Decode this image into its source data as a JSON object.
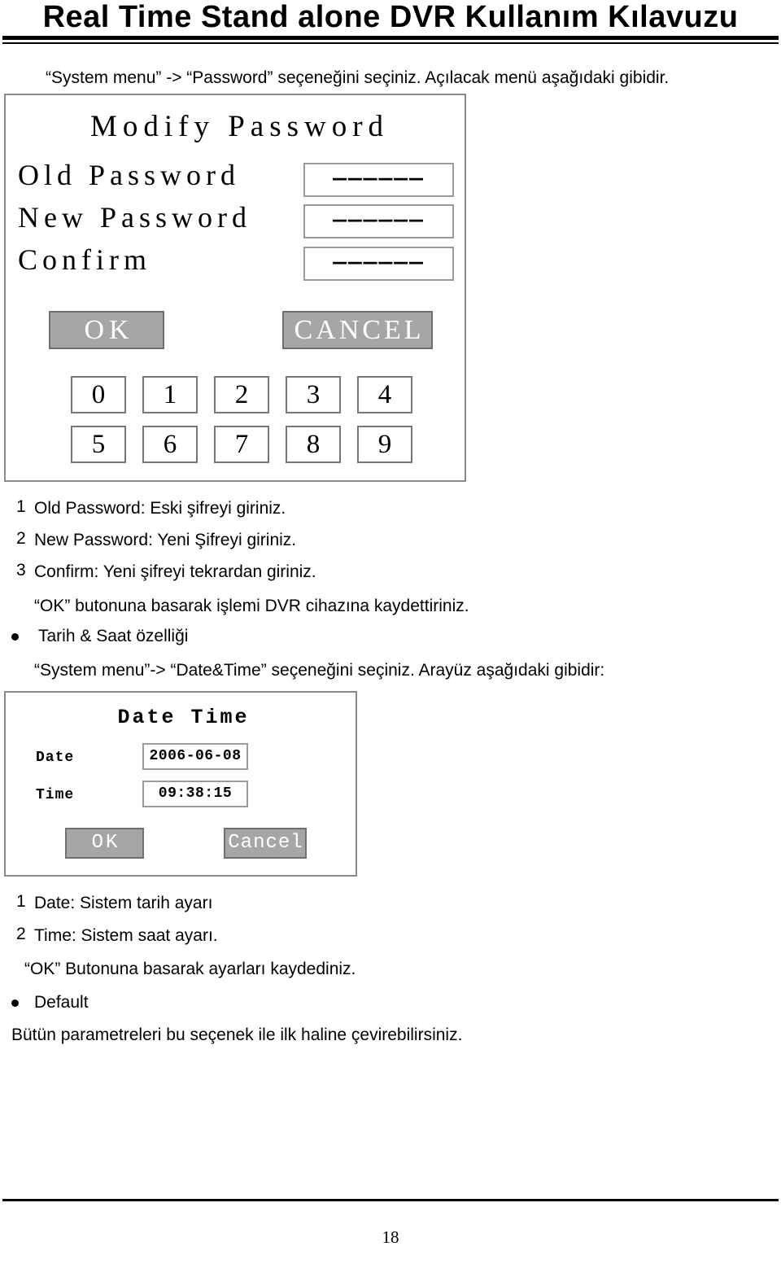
{
  "header": {
    "title": "Real Time Stand alone DVR Kullanım Kılavuzu"
  },
  "intro_paragraph": "“System menu” -> “Password” seçeneğini seçiniz. Açılacak menü aşağıdaki gibidir.",
  "password_dialog": {
    "title": "Modify Password",
    "fields": [
      {
        "label": "Old Password",
        "value": "——————"
      },
      {
        "label": "New Password",
        "value": "——————"
      },
      {
        "label": "Confirm",
        "value": "——————"
      }
    ],
    "ok_label": "OK",
    "cancel_label": "CANCEL",
    "keypad_row1": [
      "0",
      "1",
      "2",
      "3",
      "4"
    ],
    "keypad_row2": [
      "5",
      "6",
      "7",
      "8",
      "9"
    ],
    "button_bg": "#a6a6a6",
    "button_text_color": "#ffffff"
  },
  "password_notes": {
    "item1_num": "1",
    "item1_text": "Old Password: Eski şifreyi giriniz.",
    "item2_num": "2",
    "item2_text": "New Password: Yeni Şifreyi giriniz.",
    "item3_num": "3",
    "item3_text": "Confirm: Yeni şifreyi tekrardan giriniz.",
    "save_text": "“OK” butonuna basarak işlemi DVR cihazına kaydettiriniz."
  },
  "datetime_section": {
    "bullet_label": "Tarih & Saat özelliği",
    "intro": "“System menu”-> “Date&Time” seçeneğini seçiniz. Arayüz aşağıdaki gibidir:"
  },
  "datetime_dialog": {
    "title": "Date Time",
    "date_label": "Date",
    "date_value": "2006-06-08",
    "time_label": "Time",
    "time_value": "09:38:15",
    "ok_label": "OK",
    "cancel_label": "Cancel"
  },
  "datetime_notes": {
    "item1_num": "1",
    "item1_text": "Date: Sistem tarih ayarı",
    "item2_num": "2",
    "item2_text": "Time: Sistem saat ayarı.",
    "save_text": "“OK” Butonuna basarak ayarları kaydediniz."
  },
  "default_section": {
    "bullet_label": "Default",
    "description": "Bütün parametreleri bu seçenek ile ilk haline çevirebilirsiniz."
  },
  "footer": {
    "page_number": "18"
  }
}
